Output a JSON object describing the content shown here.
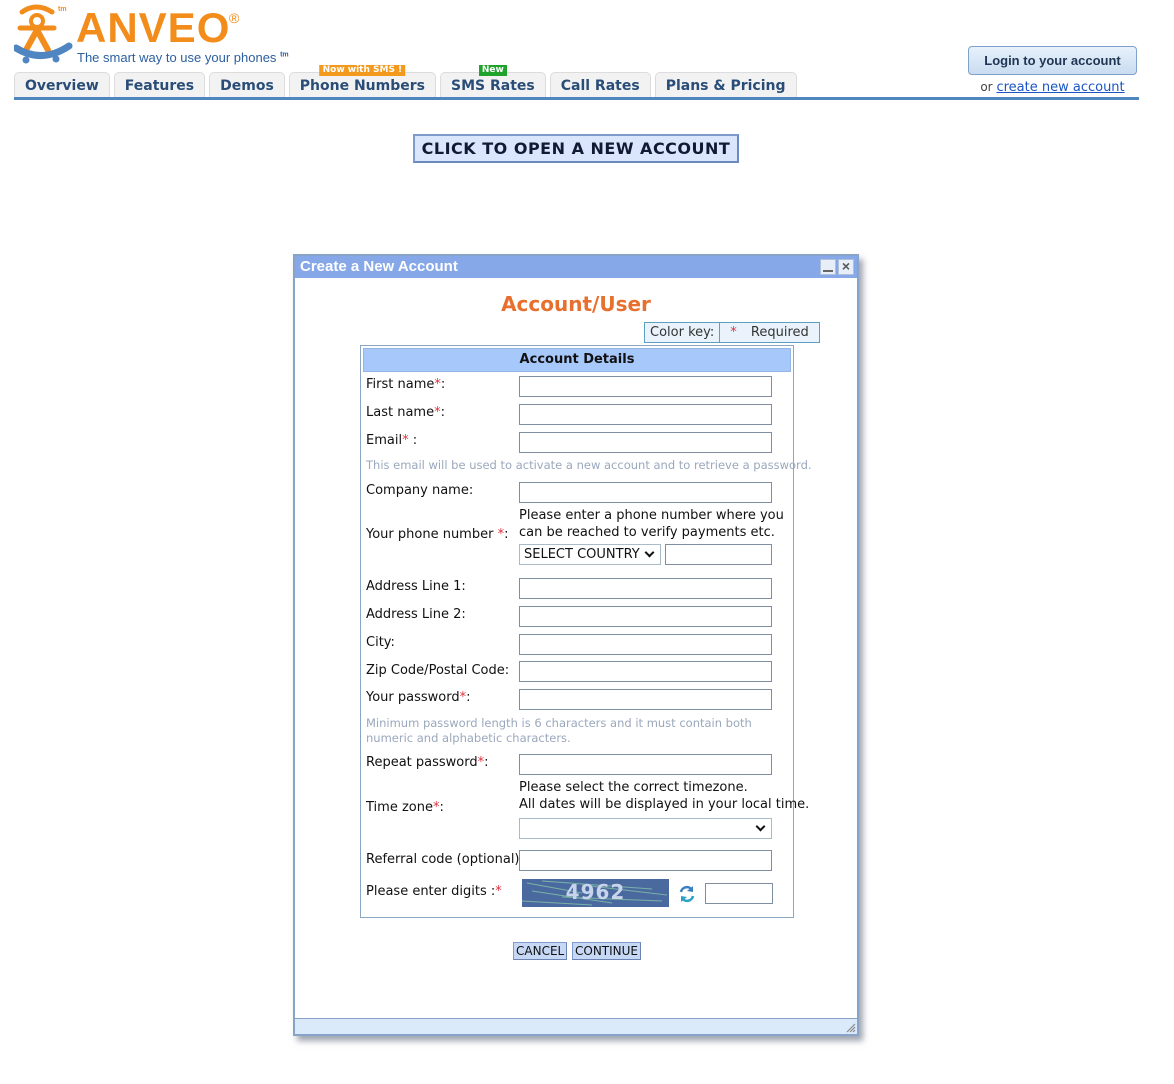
{
  "brand": {
    "name": "ANVEO",
    "registered": "®",
    "tm": "tm",
    "tagline": "The smart way to use your phones",
    "tagline_tm": "tm",
    "orange": "#f28c1a",
    "blue": "#2b5fa0"
  },
  "nav": {
    "tabs": [
      {
        "label": "Overview"
      },
      {
        "label": "Features"
      },
      {
        "label": "Demos"
      },
      {
        "label": "Phone Numbers",
        "badge": "Now with SMS !"
      },
      {
        "label": "SMS Rates",
        "badge": "New"
      },
      {
        "label": "Call Rates"
      },
      {
        "label": "Plans & Pricing"
      }
    ]
  },
  "account": {
    "login_label": "Login to your account",
    "or_text": "or",
    "create_link": "create new account"
  },
  "open_account_button": "CLICK TO OPEN A NEW ACCOUNT",
  "dialog": {
    "title": "Create a New Account",
    "minimize_icon": "minimize-icon",
    "close_icon": "close-icon",
    "close_glyph": "×",
    "heading": "Account/User",
    "color_key": {
      "label": "Color key:",
      "asterisk": "*",
      "required": "Required"
    },
    "section_title": "Account Details",
    "fields": {
      "first_name": {
        "label": "First name",
        "req": "*",
        "suffix": ":",
        "value": ""
      },
      "last_name": {
        "label": "Last name",
        "req": "*",
        "suffix": ":",
        "value": ""
      },
      "email": {
        "label": "Email",
        "req": "*",
        "suffix": " :",
        "value": ""
      },
      "email_hint": "This email will be used to activate a new account and to retrieve a password.",
      "company": {
        "label": "Company name:",
        "value": ""
      },
      "phone": {
        "label": "Your phone number ",
        "req": "*",
        "suffix": ":",
        "note_line1": "Please enter a phone number where you",
        "note_line2": "can be reached to verify payments etc.",
        "country_selected": "SELECT COUNTRY",
        "value": ""
      },
      "address1": {
        "label": "Address Line 1:",
        "value": ""
      },
      "address2": {
        "label": "Address Line 2:",
        "value": ""
      },
      "city": {
        "label": "City:",
        "value": ""
      },
      "zip": {
        "label": "Zip Code/Postal Code:",
        "value": ""
      },
      "password": {
        "label": "Your password",
        "req": "*",
        "suffix": ":",
        "value": ""
      },
      "password_hint": "Minimum password length is 6 characters and it must contain both numeric and alphabetic characters.",
      "repeat_password": {
        "label": "Repeat password",
        "req": "*",
        "suffix": ":",
        "value": ""
      },
      "timezone": {
        "label": "Time zone",
        "req": "*",
        "suffix": ":",
        "note_line1": "Please select the correct timezone.",
        "note_line2": "All dates will be displayed in your local time.",
        "selected": ""
      },
      "referral": {
        "label": "Referral code (optional):",
        "value": ""
      },
      "captcha": {
        "label": "Please enter digits :",
        "req": "*",
        "image_text": "4962",
        "value": ""
      }
    },
    "buttons": {
      "cancel": "CANCEL",
      "continue": "CONTINUE"
    }
  }
}
